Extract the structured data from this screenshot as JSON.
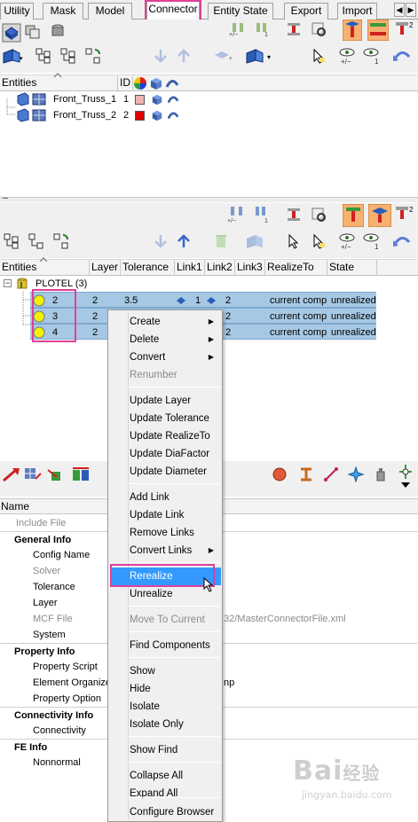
{
  "tabs": [
    "Utility",
    "Mask",
    "Model",
    "Connector",
    "Entity State",
    "Export",
    "Import"
  ],
  "active_tab": "Connector",
  "top_panel": {
    "columns": [
      "Entities",
      "ID"
    ],
    "rows": [
      {
        "name": "Front_Truss_1",
        "id": "1",
        "color": "#f2b3b3"
      },
      {
        "name": "Front_Truss_2",
        "id": "2",
        "color": "#e00000"
      }
    ]
  },
  "mid_panel": {
    "columns": [
      "Entities",
      "Layer",
      "Tolerance",
      "Link1",
      "Link2",
      "Link3",
      "RealizeTo",
      "State"
    ],
    "group": {
      "label": "PLOTEL (3)"
    },
    "rows": [
      {
        "id": "2",
        "layer": "2",
        "tolerance": "3.5",
        "link1": "1",
        "link2": "2",
        "realize_to": "current comp",
        "state": "unrealized"
      },
      {
        "id": "3",
        "layer": "2",
        "tolerance": "",
        "link1": "",
        "link2": "2",
        "realize_to": "current comp",
        "state": "unrealized"
      },
      {
        "id": "4",
        "layer": "2",
        "tolerance": "",
        "link1": "",
        "link2": "2",
        "realize_to": "current comp",
        "state": "unrealized"
      }
    ]
  },
  "props": {
    "header": "Name",
    "rows": [
      {
        "label": "Include File",
        "type": "grey",
        "value": ""
      },
      {
        "label": "General Info",
        "type": "group",
        "value": ""
      },
      {
        "label": "Config Name",
        "type": "item",
        "value": ""
      },
      {
        "label": "Solver",
        "type": "grey",
        "value": ""
      },
      {
        "label": "Tolerance",
        "type": "item",
        "value": ""
      },
      {
        "label": "Layer",
        "type": "item",
        "value": ""
      },
      {
        "label": "MCF File",
        "type": "grey",
        "value": "32/MasterConnectorFile.xml"
      },
      {
        "label": "System",
        "type": "item",
        "value": ""
      },
      {
        "label": "Property Info",
        "type": "group",
        "value": ""
      },
      {
        "label": "Property Script",
        "type": "item",
        "value": ""
      },
      {
        "label": "Element Organize",
        "type": "item",
        "value": "np"
      },
      {
        "label": "Property Option",
        "type": "item",
        "value": ""
      },
      {
        "label": "Connectivity Info",
        "type": "group",
        "value": ""
      },
      {
        "label": "Connectivity",
        "type": "item",
        "value": ""
      },
      {
        "label": "FE Info",
        "type": "group",
        "value": ""
      },
      {
        "label": "Nonnormal",
        "type": "item",
        "value": ""
      }
    ]
  },
  "menu": {
    "items": [
      {
        "label": "Create",
        "sub": true,
        "disabled": false
      },
      {
        "label": "Delete",
        "sub": true,
        "disabled": false
      },
      {
        "label": "Convert",
        "sub": true,
        "disabled": false
      },
      {
        "label": "Renumber",
        "sub": false,
        "disabled": true
      },
      {
        "label": "Update Layer",
        "sub": false,
        "disabled": false
      },
      {
        "label": "Update Tolerance",
        "sub": false,
        "disabled": false
      },
      {
        "label": "Update RealizeTo",
        "sub": false,
        "disabled": false
      },
      {
        "label": "Update DiaFactor",
        "sub": false,
        "disabled": false
      },
      {
        "label": "Update Diameter",
        "sub": false,
        "disabled": false
      },
      {
        "label": "Add Link",
        "sub": false,
        "disabled": false
      },
      {
        "label": "Update Link",
        "sub": false,
        "disabled": false
      },
      {
        "label": "Remove Links",
        "sub": false,
        "disabled": false
      },
      {
        "label": "Convert Links",
        "sub": true,
        "disabled": false
      },
      {
        "label": "Rerealize",
        "sub": false,
        "disabled": false
      },
      {
        "label": "Unrealize",
        "sub": false,
        "disabled": false
      },
      {
        "label": "Move To Current",
        "sub": false,
        "disabled": true
      },
      {
        "label": "Find Components",
        "sub": false,
        "disabled": false
      },
      {
        "label": "Show",
        "sub": false,
        "disabled": false
      },
      {
        "label": "Hide",
        "sub": false,
        "disabled": false
      },
      {
        "label": "Isolate",
        "sub": false,
        "disabled": false
      },
      {
        "label": "Isolate Only",
        "sub": false,
        "disabled": false
      },
      {
        "label": "Show Find",
        "sub": false,
        "disabled": false
      },
      {
        "label": "Collapse All",
        "sub": false,
        "disabled": false
      },
      {
        "label": "Expand All",
        "sub": false,
        "disabled": false
      },
      {
        "label": "Configure Browser",
        "sub": false,
        "disabled": false
      }
    ]
  },
  "watermark": {
    "text": "Bai",
    "suffix": "经验",
    "url": "jingyan.baidu.com"
  },
  "colors": {
    "highlight": "#e0409a",
    "selection": "#a6c8e4",
    "menu_hover": "#3399ff"
  }
}
